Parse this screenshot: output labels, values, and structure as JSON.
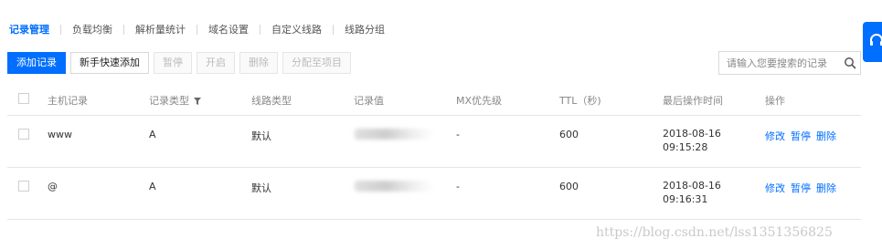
{
  "tabs": [
    "记录管理",
    "负载均衡",
    "解析量统计",
    "域名设置",
    "自定义线路",
    "线路分组"
  ],
  "toolbar": {
    "add_record": "添加记录",
    "quick_add": "新手快速添加",
    "pause": "暂停",
    "enable": "开启",
    "delete": "删除",
    "assign_project": "分配至项目"
  },
  "search": {
    "placeholder": "请输入您要搜索的记录"
  },
  "table": {
    "headers": {
      "host": "主机记录",
      "type": "记录类型",
      "line": "线路类型",
      "value": "记录值",
      "mx": "MX优先级",
      "ttl": "TTL（秒)",
      "last_op": "最后操作时间",
      "actions": "操作"
    },
    "rows": [
      {
        "host": "www",
        "type": "A",
        "line": "默认",
        "mx": "-",
        "ttl": "600",
        "date": "2018-08-16",
        "time": "09:15:28"
      },
      {
        "host": "@",
        "type": "A",
        "line": "默认",
        "mx": "-",
        "ttl": "600",
        "date": "2018-08-16",
        "time": "09:16:31"
      }
    ],
    "row_actions": {
      "edit": "修改",
      "pause": "暂停",
      "delete": "删除"
    }
  },
  "watermark": "https://blog.csdn.net/lss1351356825",
  "colors": {
    "accent": "#006eff",
    "border": "#e6e6e6",
    "muted_text": "#888888"
  },
  "icons": {
    "search": "search-icon",
    "filter": "filter-icon",
    "side_widget": "headset-icon"
  }
}
